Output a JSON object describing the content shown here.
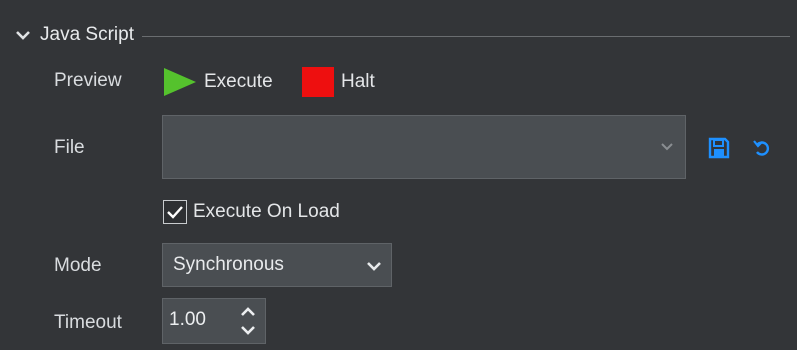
{
  "section": {
    "title": "Java Script"
  },
  "preview": {
    "label": "Preview",
    "execute_label": "Execute",
    "halt_label": "Halt"
  },
  "file": {
    "label": "File",
    "value": ""
  },
  "execute_on_load": {
    "label": "Execute On Load",
    "checked": true
  },
  "mode": {
    "label": "Mode",
    "value": "Synchronous"
  },
  "timeout": {
    "label": "Timeout",
    "value": "1.00"
  },
  "icons": {
    "collapse": "chevron-down-icon",
    "execute": "play-icon",
    "halt": "stop-icon",
    "save": "save-icon",
    "reset": "reset-icon",
    "dropdown": "chevron-down-icon",
    "check": "check-icon",
    "spin_up": "chevron-up-icon",
    "spin_down": "chevron-down-icon"
  },
  "colors": {
    "panel_bg": "#333538",
    "field_bg": "#4a4e52",
    "execute_green": "#55c22d",
    "halt_red": "#ee0f0f",
    "accent_blue": "#1e90ff"
  }
}
